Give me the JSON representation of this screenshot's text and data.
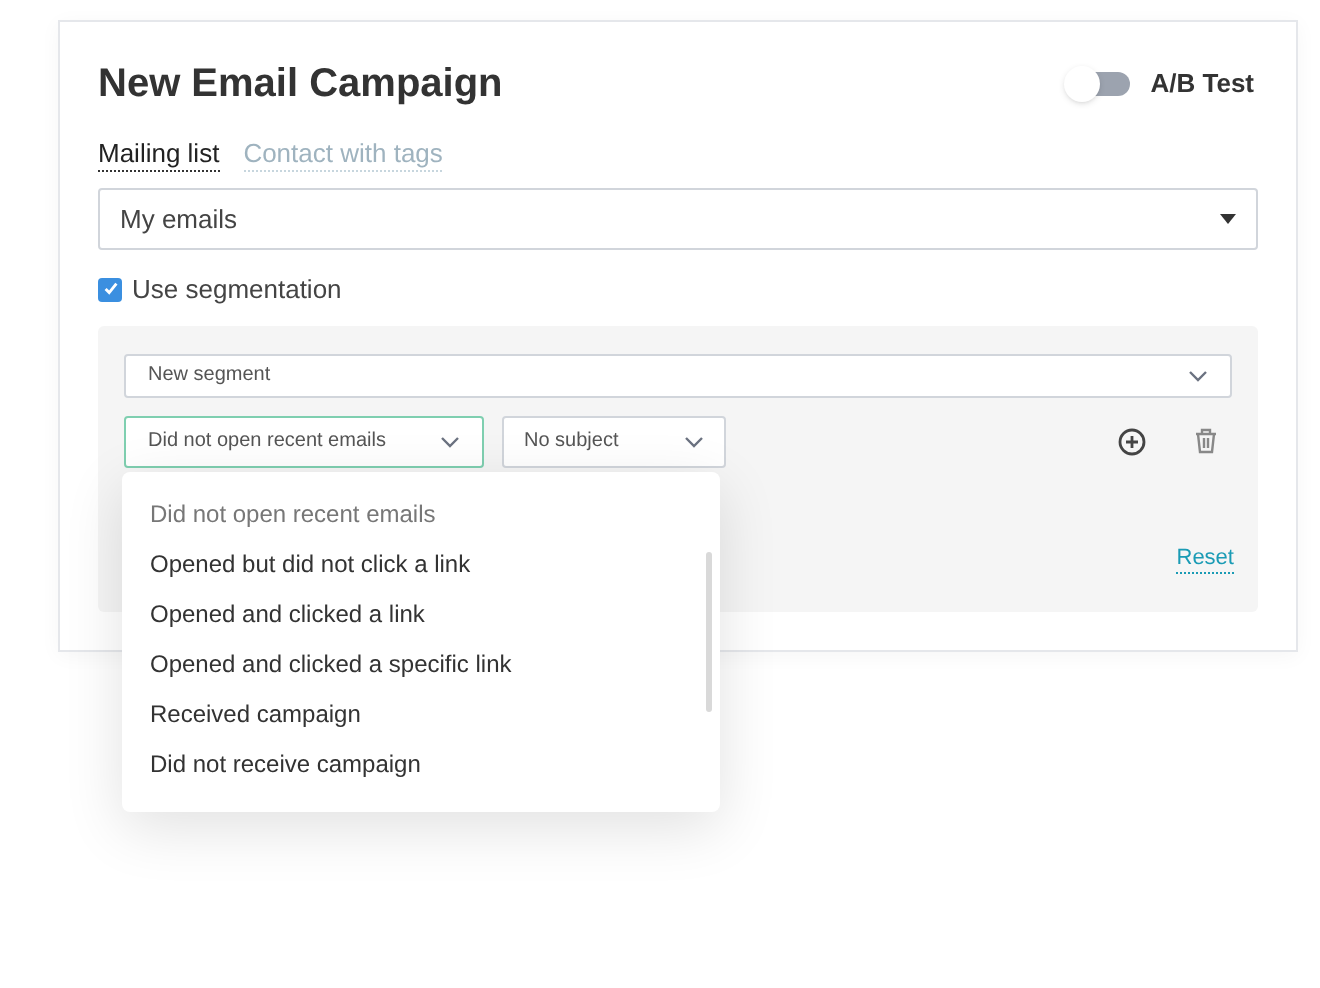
{
  "title": "New Email Campaign",
  "ab_test": {
    "label": "A/B Test",
    "on": false
  },
  "tabs": [
    {
      "label": "Mailing list",
      "selected": true
    },
    {
      "label": "Contact with tags",
      "selected": false
    }
  ],
  "list_select": {
    "value": "My emails"
  },
  "segmentation": {
    "label": "Use segmentation",
    "checked": true
  },
  "segment": {
    "select": {
      "value": "New segment"
    },
    "condition": {
      "value": "Did not open recent emails"
    },
    "subject": {
      "value": "No subject"
    },
    "reset": "Reset"
  },
  "dropdown": {
    "options": [
      {
        "label": "Did not open recent emails",
        "selected": true
      },
      {
        "label": "Opened but did not click a link",
        "selected": false
      },
      {
        "label": "Opened and clicked a link",
        "selected": false
      },
      {
        "label": "Opened and clicked a specific link",
        "selected": false
      },
      {
        "label": "Received campaign",
        "selected": false
      },
      {
        "label": "Did not receive campaign",
        "selected": false
      }
    ]
  }
}
